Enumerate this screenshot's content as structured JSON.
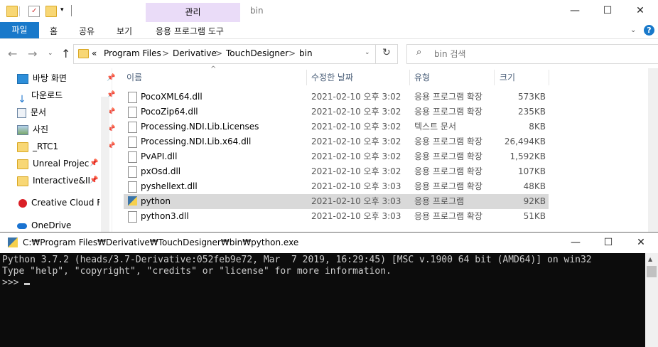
{
  "explorer": {
    "title": "bin",
    "manage_tab": "관리",
    "ribbon_tabs": [
      "파일",
      "홈",
      "공유",
      "보기"
    ],
    "manage_subtab": "응용 프로그램 도구",
    "breadcrumb": [
      "«",
      "Program Files",
      ">",
      "Derivative",
      ">",
      "TouchDesigner",
      ">",
      "bin"
    ],
    "search_placeholder": "bin 검색",
    "sidebar": [
      {
        "label": "바탕 화면",
        "icon": "desktop-icon",
        "pinned": true
      },
      {
        "label": "다운로드",
        "icon": "download-icon",
        "pinned": true
      },
      {
        "label": "문서",
        "icon": "document-icon",
        "pinned": true
      },
      {
        "label": "사진",
        "icon": "picture-icon",
        "pinned": true
      },
      {
        "label": "_RTC1",
        "icon": "folder-icon",
        "pinned": true
      },
      {
        "label": "Unreal Projec",
        "icon": "folder-icon",
        "pinned": true
      },
      {
        "label": "Interactive&II",
        "icon": "folder-icon",
        "pinned": true
      },
      {
        "label": "Creative Cloud Fil",
        "icon": "creative-cloud-icon",
        "pinned": false
      },
      {
        "label": "OneDrive",
        "icon": "onedrive-icon",
        "pinned": false
      }
    ],
    "columns": {
      "name": "이름",
      "date": "수정한 날짜",
      "type": "유형",
      "size": "크기"
    },
    "files": [
      {
        "name": "PocoXML64.dll",
        "date": "2021-02-10 오후 3:02",
        "type": "응용 프로그램 확장",
        "size": "573KB"
      },
      {
        "name": "PocoZip64.dll",
        "date": "2021-02-10 오후 3:02",
        "type": "응용 프로그램 확장",
        "size": "235KB"
      },
      {
        "name": "Processing.NDI.Lib.Licenses",
        "date": "2021-02-10 오후 3:02",
        "type": "텍스트 문서",
        "size": "8KB"
      },
      {
        "name": "Processing.NDI.Lib.x64.dll",
        "date": "2021-02-10 오후 3:02",
        "type": "응용 프로그램 확장",
        "size": "26,494KB"
      },
      {
        "name": "PvAPI.dll",
        "date": "2021-02-10 오후 3:02",
        "type": "응용 프로그램 확장",
        "size": "1,592KB"
      },
      {
        "name": "pxOsd.dll",
        "date": "2021-02-10 오후 3:02",
        "type": "응용 프로그램 확장",
        "size": "107KB"
      },
      {
        "name": "pyshellext.dll",
        "date": "2021-02-10 오후 3:03",
        "type": "응용 프로그램 확장",
        "size": "48KB"
      },
      {
        "name": "python",
        "date": "2021-02-10 오후 3:03",
        "type": "응용 프로그램",
        "size": "92KB",
        "selected": true
      },
      {
        "name": "python3.dll",
        "date": "2021-02-10 오후 3:03",
        "type": "응용 프로그램 확장",
        "size": "51KB"
      }
    ]
  },
  "console": {
    "title": "C:₩Program Files₩Derivative₩TouchDesigner₩bin₩python.exe",
    "lines": [
      "Python 3.7.2 (heads/3.7-Derivative:052feb9e72, Mar  7 2019, 16:29:45) [MSC v.1900 64 bit (AMD64)] on win32",
      "Type \"help\", \"copyright\", \"credits\" or \"license\" for more information.",
      ">>> "
    ]
  }
}
